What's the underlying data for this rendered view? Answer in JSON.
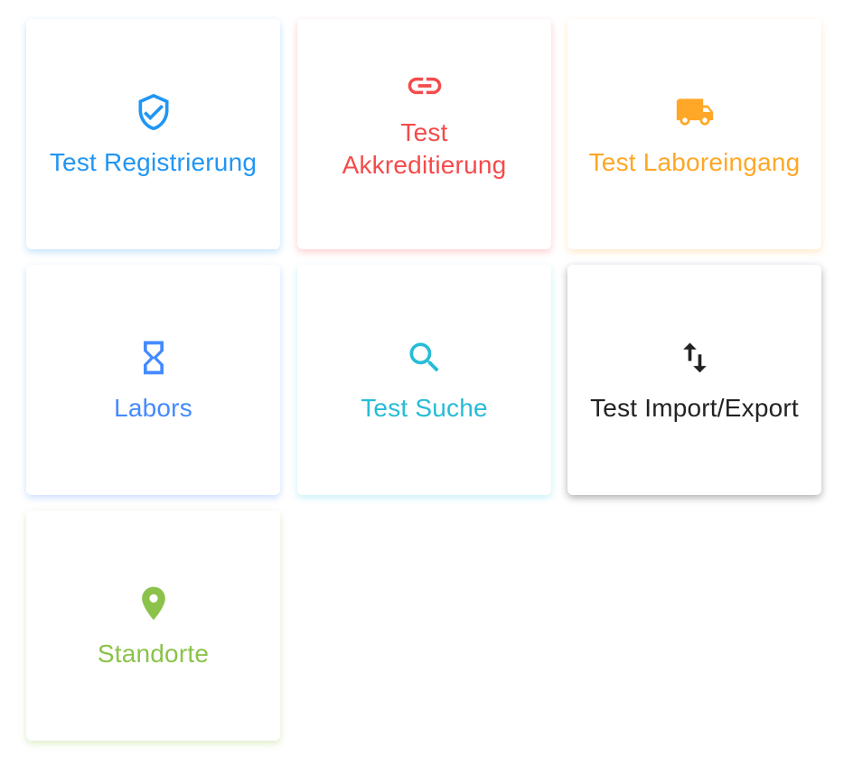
{
  "tiles": [
    {
      "id": "test-registrierung",
      "label": "Test Registrierung",
      "icon": "shield-check-icon",
      "color": "#2196f3"
    },
    {
      "id": "test-akkreditierung",
      "label": "Test Akkreditierung",
      "icon": "link-icon",
      "color": "#f44b4b"
    },
    {
      "id": "test-laboreingang",
      "label": "Test Laboreingang",
      "icon": "truck-icon",
      "color": "#ffa726"
    },
    {
      "id": "labors",
      "label": "Labors",
      "icon": "hourglass-icon",
      "color": "#448aff"
    },
    {
      "id": "test-suche",
      "label": "Test Suche",
      "icon": "search-icon",
      "color": "#26bcd6"
    },
    {
      "id": "test-import-export",
      "label": "Test Import/Export",
      "icon": "swap-vertical-icon",
      "color": "#222222"
    },
    {
      "id": "standorte",
      "label": "Standorte",
      "icon": "map-marker-icon",
      "color": "#8bc34a"
    }
  ]
}
